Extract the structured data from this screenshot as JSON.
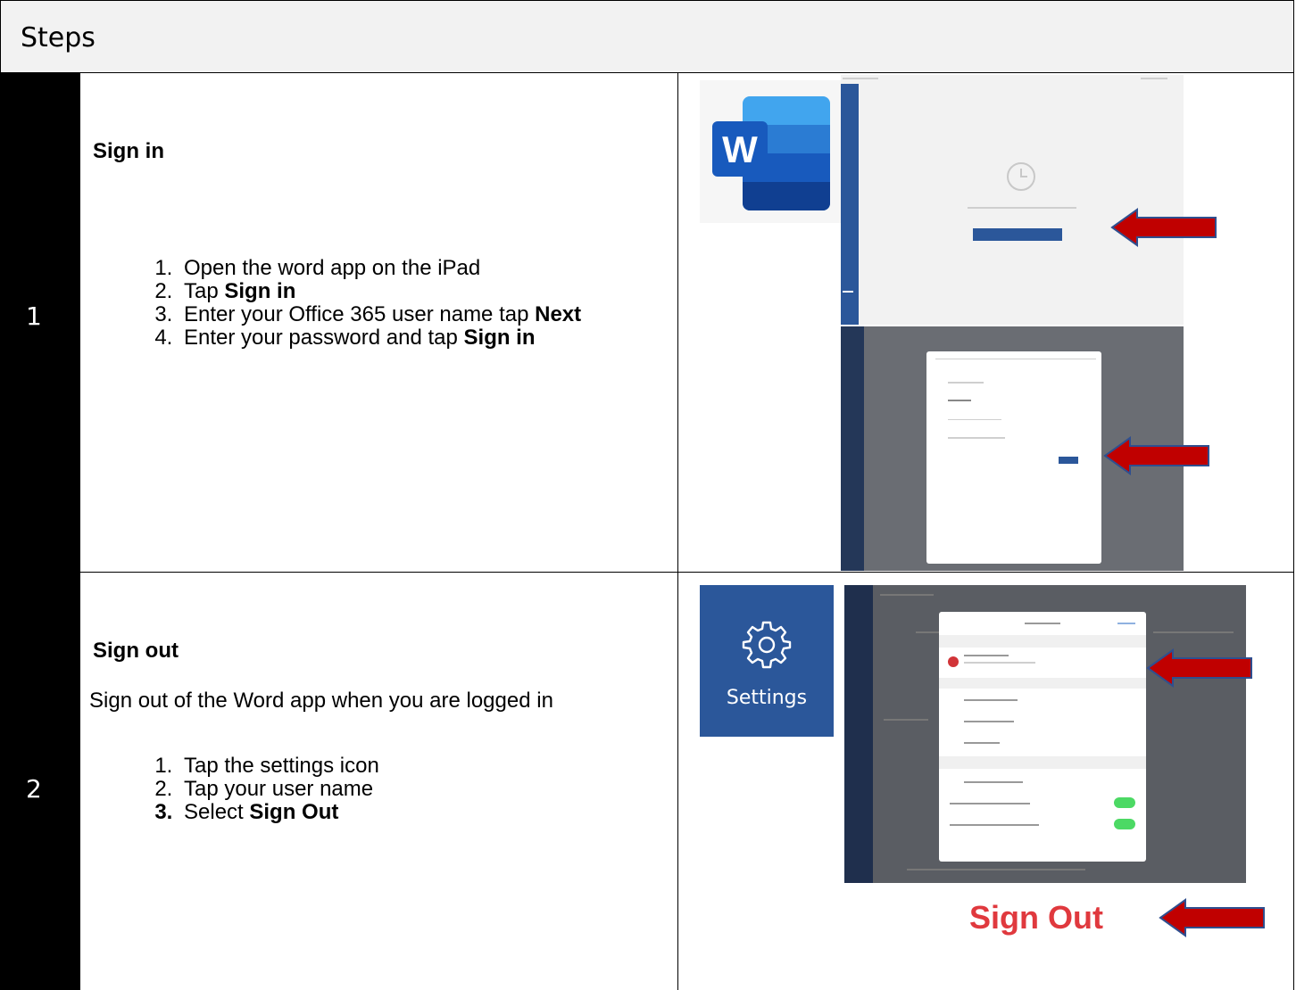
{
  "header": {
    "title": "Steps"
  },
  "steps": [
    {
      "number": "1",
      "title": "Sign in",
      "items": [
        {
          "text": "Open the word app on the iPad",
          "bold": ""
        },
        {
          "text": "Tap ",
          "bold": "Sign in"
        },
        {
          "text": "Enter your Office 365 user name tap ",
          "bold": "Next"
        },
        {
          "text": "Enter your password and tap ",
          "bold": "Sign in"
        }
      ],
      "word_icon_letter": "W"
    },
    {
      "number": "2",
      "title": "Sign out",
      "intro": "Sign out of the Word app when you are logged in",
      "items": [
        {
          "text": "Tap the settings icon",
          "bold": ""
        },
        {
          "text": "Tap your user name",
          "bold": ""
        },
        {
          "text": "Select ",
          "bold": "Sign Out"
        }
      ],
      "settings_label": "Settings",
      "sign_out_label": "Sign Out"
    }
  ],
  "icons": [
    "word-app-icon",
    "gear-icon",
    "arrow-left-icon"
  ],
  "colors": {
    "arrow": "#c00000",
    "arrow_border": "#2f4f8f",
    "word_blue": "#2b579a",
    "sign_out_red": "#e0393e"
  }
}
